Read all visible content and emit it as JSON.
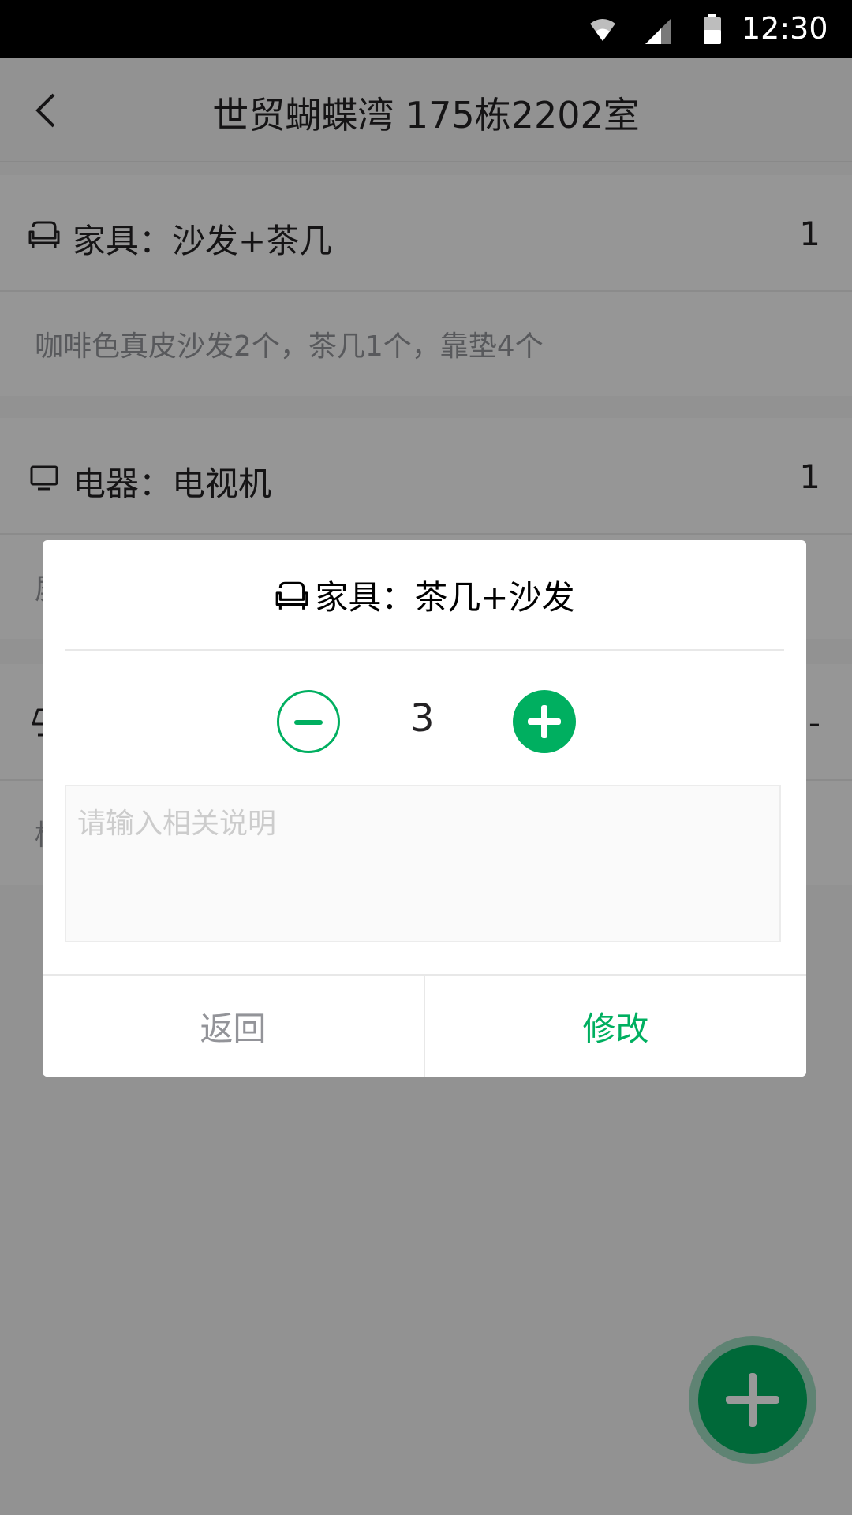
{
  "status_bar": {
    "time": "12:30",
    "icons": [
      "wifi-icon",
      "signal-icon",
      "battery-icon"
    ]
  },
  "header": {
    "back_icon": "chevron-left-icon",
    "title": "世贸蝴蝶湾 175栋2202室"
  },
  "list": [
    {
      "icon": "sofa-icon",
      "name": "家具：沙发+茶几",
      "qty": "1",
      "desc": "咖啡色真皮沙发2个，茶几1个，靠垫4个"
    },
    {
      "icon": "tv-icon",
      "name": "电器：电视机",
      "qty": "1",
      "desc": "屏"
    },
    {
      "icon": "lamp-icon",
      "name": "",
      "qty": "-",
      "desc": "柜"
    }
  ],
  "dialog": {
    "title_icon": "sofa-icon",
    "title": "家具：茶几+沙发",
    "count": "3",
    "note_placeholder": "请输入相关说明",
    "back_label": "返回",
    "edit_label": "修改"
  },
  "colors": {
    "accent": "#00af60",
    "text_dark": "#242224",
    "text_gray": "#939499",
    "placeholder": "#cccccc"
  },
  "fab": {
    "icon": "plus-icon"
  }
}
